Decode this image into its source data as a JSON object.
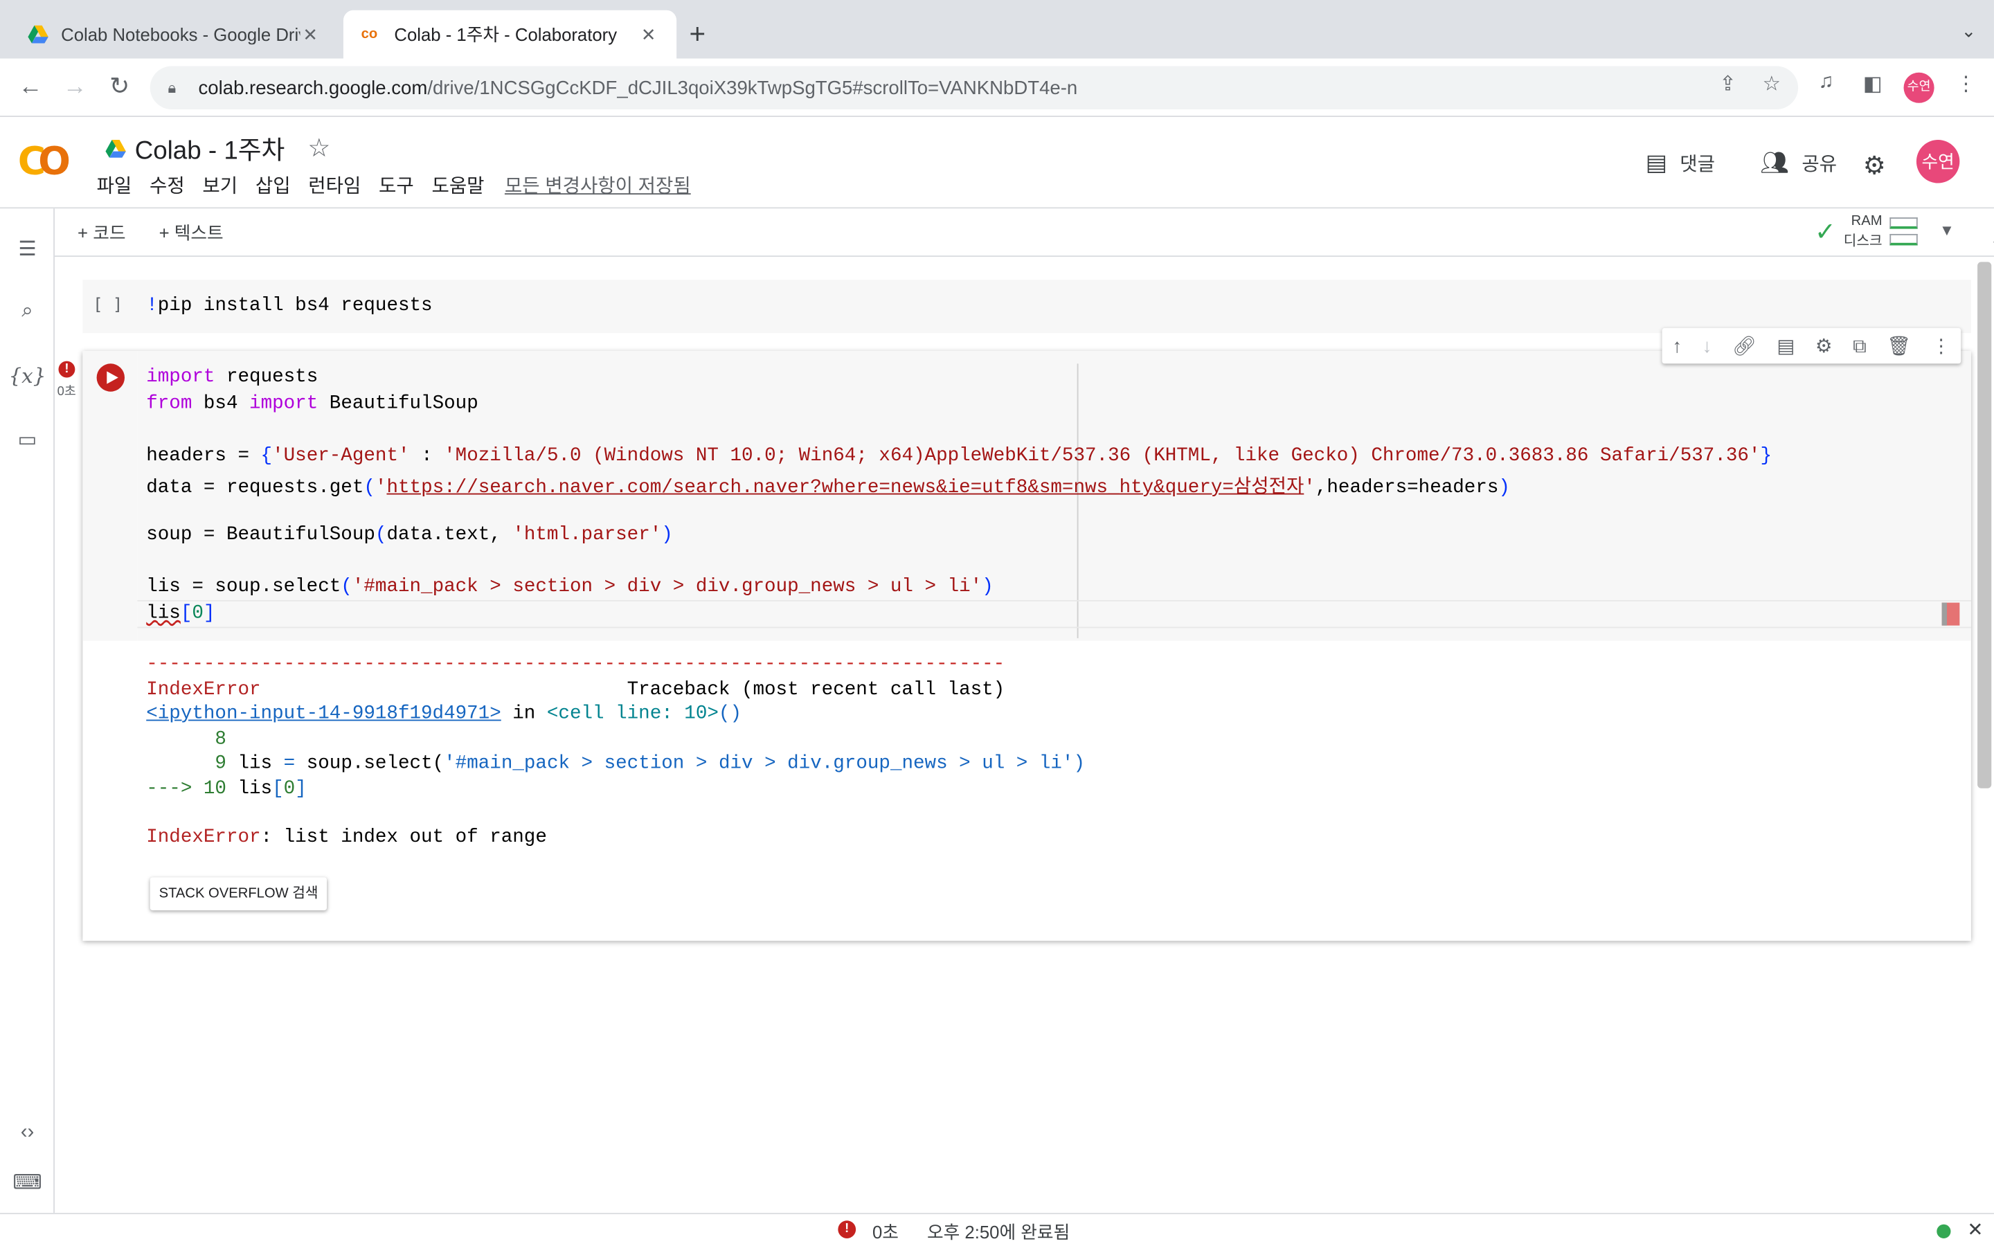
{
  "browser": {
    "tabs": [
      {
        "title": "Colab Notebooks - Google Driv",
        "active": false
      },
      {
        "title": "Colab - 1주차 - Colaboratory",
        "active": true
      }
    ],
    "url_host": "colab.research.google.com",
    "url_path": "/drive/1NCSGgCcKDF_dCJIL3qoiX39kTwpSgTG5#scrollTo=VANKNbDT4e-n",
    "profile_initials": "수연"
  },
  "colab": {
    "logo": "CO",
    "doc_title": "Colab - 1주차",
    "menu": [
      "파일",
      "수정",
      "보기",
      "삽입",
      "런타임",
      "도구",
      "도움말"
    ],
    "saved_status": "모든 변경사항이 저장됨",
    "comment_label": "댓글",
    "share_label": "공유",
    "avatar_initials": "수연",
    "add_code": "+ 코드",
    "add_text": "+ 텍스트",
    "ram_label": "RAM",
    "disk_label": "디스크"
  },
  "cell1": {
    "bracket": "[ ]",
    "code_bang": "!",
    "code_rest": "pip install bs4 requests"
  },
  "cell2": {
    "exec_time": "0초",
    "lines": {
      "l1_kw": "import",
      "l1_rest": " requests",
      "l2_kw1": "from",
      "l2_mid": " bs4 ",
      "l2_kw2": "import",
      "l2_rest": " BeautifulSoup",
      "l4_a": "headers = ",
      "l4_b": "{",
      "l4_c": "'User-Agent'",
      "l4_d": " : ",
      "l4_e": "'Mozilla/5.0 (Windows NT 10.0; Win64; x64)AppleWebKit/537.36 (KHTML, like Gecko) Chrome/73.0.3683.86 Safari/537.36'",
      "l4_f": "}",
      "l5_a": "data = requests.get",
      "l5_b": "(",
      "l5_c": "'",
      "l5_url": "https://search.naver.com/search.naver?where=news&ie=utf8&sm=nws_hty&query=삼성전자",
      "l5_d": "'",
      "l5_e": ",headers=headers",
      "l5_f": ")",
      "l7_a": "soup = BeautifulSoup",
      "l7_b": "(",
      "l7_c": "data.text, ",
      "l7_d": "'html.parser'",
      "l7_e": ")",
      "l9_a": "lis = soup.select",
      "l9_b": "(",
      "l9_c": "'#main_pack > section > div > div.group_news > ul > li'",
      "l9_d": ")",
      "l10_a": "lis",
      "l10_b": "[",
      "l10_c": "0",
      "l10_d": "]"
    }
  },
  "output": {
    "dashes": "---------------------------------------------------------------------------",
    "err_name": "IndexError",
    "traceback": "                                Traceback (most recent call last)",
    "input_link": "<ipython-input-14-9918f19d4971>",
    "in_word": " in ",
    "cell_line": "<cell line: 10>",
    "paren": "()",
    "line8": "      8",
    "line9_num": "      9",
    "line9_code_a": " lis ",
    "line9_eq": "=",
    "line9_code_b": " soup.select(",
    "line9_str": "'#main_pack > section > div > div.group_news > ul > li'",
    "line9_close": ")",
    "arrow": "---> 10",
    "line10_a": " lis",
    "line10_b": "[",
    "line10_c": "0",
    "line10_d": "]",
    "final_name": "IndexError",
    "final_msg": ": list index out of range",
    "so_button": "STACK OVERFLOW 검색"
  },
  "statusbar": {
    "time": "0초",
    "completed": "오후 2:50에 완료됨"
  },
  "colors": {
    "error_red": "#c5221f",
    "colab_orange": "#f9ab00",
    "profile_pink": "#e8487a",
    "ok_green": "#34a853"
  }
}
